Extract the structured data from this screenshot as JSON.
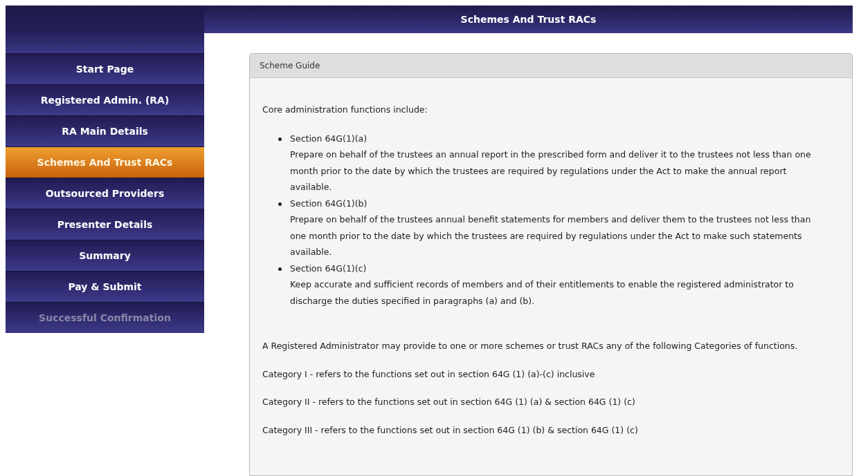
{
  "header": {
    "title": "Schemes And Trust RACs"
  },
  "sidebar": {
    "items": [
      {
        "label": "Start Page",
        "selected": false,
        "disabled": false
      },
      {
        "label": "Registered Admin. (RA)",
        "selected": false,
        "disabled": false
      },
      {
        "label": "RA Main Details",
        "selected": false,
        "disabled": false
      },
      {
        "label": "Schemes And Trust RACs",
        "selected": true,
        "disabled": false
      },
      {
        "label": "Outsourced Providers",
        "selected": false,
        "disabled": false
      },
      {
        "label": "Presenter Details",
        "selected": false,
        "disabled": false
      },
      {
        "label": "Summary",
        "selected": false,
        "disabled": false
      },
      {
        "label": "Pay & Submit",
        "selected": false,
        "disabled": false
      },
      {
        "label": "Successful Confirmation",
        "selected": false,
        "disabled": true
      }
    ]
  },
  "panel": {
    "title": "Scheme Guide",
    "intro": "Core administration functions include:",
    "functions": [
      {
        "section": "Section 64G(1)(a)",
        "text": "Prepare on behalf of the trustees an annual report in the prescribed form and deliver it to the trustees not less than one month prior to the date by which the trustees are required by regulations under the Act to make the annual report available."
      },
      {
        "section": "Section 64G(1)(b)",
        "text": "Prepare on behalf of the trustees annual benefit statements for members and deliver them to the trustees not less than one month prior to the date by which the trustees are required by regulations under the Act to make such statements available."
      },
      {
        "section": "Section 64G(1)(c)",
        "text": "Keep accurate and sufficient records of members and of their entitlements to enable the registered administrator to discharge the duties specified in paragraphs (a) and (b)."
      }
    ],
    "paragraphs": [
      "A Registered Administrator may provide to one or more schemes or trust RACs any of the following Categories of functions.",
      "Category I - refers to the functions set out in section 64G (1) (a)-(c) inclusive",
      "Category II - refers to the functions set out in section 64G (1) (a) & section 64G (1) (c)",
      "Category III - refers to the functions set out in section 64G (1) (b) & section 64G (1) (c)"
    ]
  }
}
